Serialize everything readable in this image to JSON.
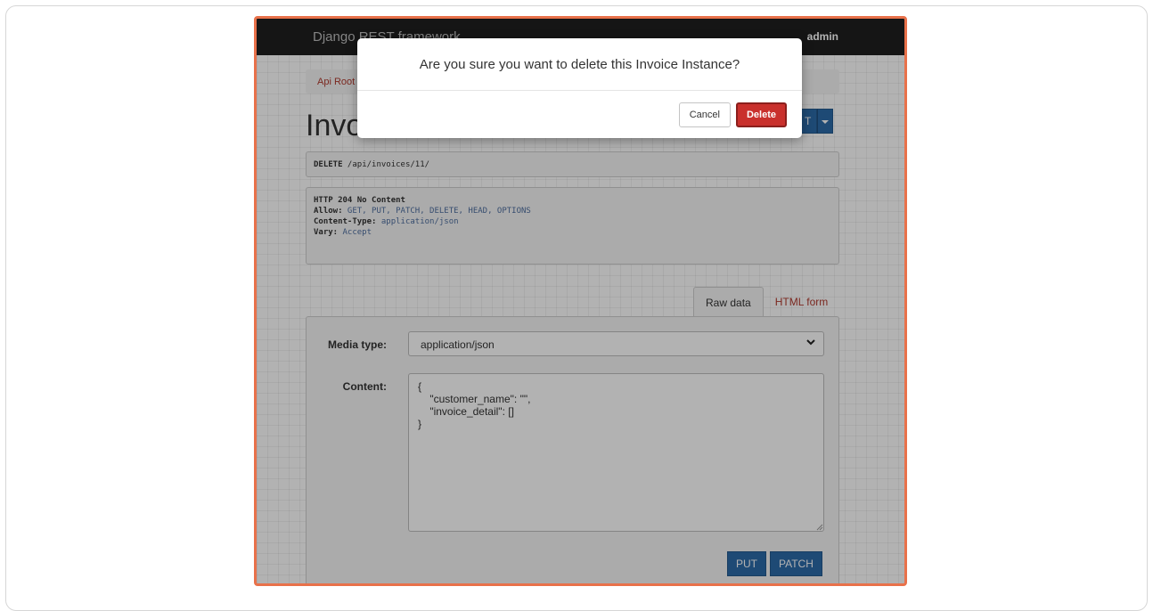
{
  "navbar": {
    "brand": "Django REST framework",
    "user": "admin"
  },
  "breadcrumb": {
    "root": "Api Root"
  },
  "page": {
    "heading": "Invo",
    "action_button": "T"
  },
  "request": {
    "method": "DELETE",
    "path": " /api/invoices/11/"
  },
  "response": {
    "status": "HTTP 204 No Content",
    "headers": [
      {
        "key": "Allow:",
        "value": " GET, PUT, PATCH, DELETE, HEAD, OPTIONS"
      },
      {
        "key": "Content-Type:",
        "value": " application/json"
      },
      {
        "key": "Vary:",
        "value": " Accept"
      }
    ]
  },
  "tabs": [
    {
      "label": "Raw data",
      "active": true
    },
    {
      "label": "HTML form",
      "active": false
    }
  ],
  "form": {
    "media_type_label": "Media type:",
    "media_type_value": "application/json",
    "content_label": "Content:",
    "content_value": "{\n    \"customer_name\": \"\",\n    \"invoice_detail\": []\n}",
    "put_label": "PUT",
    "patch_label": "PATCH"
  },
  "modal": {
    "message": "Are you sure you want to delete this Invoice Instance?",
    "cancel_label": "Cancel",
    "delete_label": "Delete"
  },
  "colors": {
    "frame_border": "#e8714a",
    "primary": "#2b6aa8",
    "danger": "#c9302c",
    "link": "#b03a2e"
  }
}
